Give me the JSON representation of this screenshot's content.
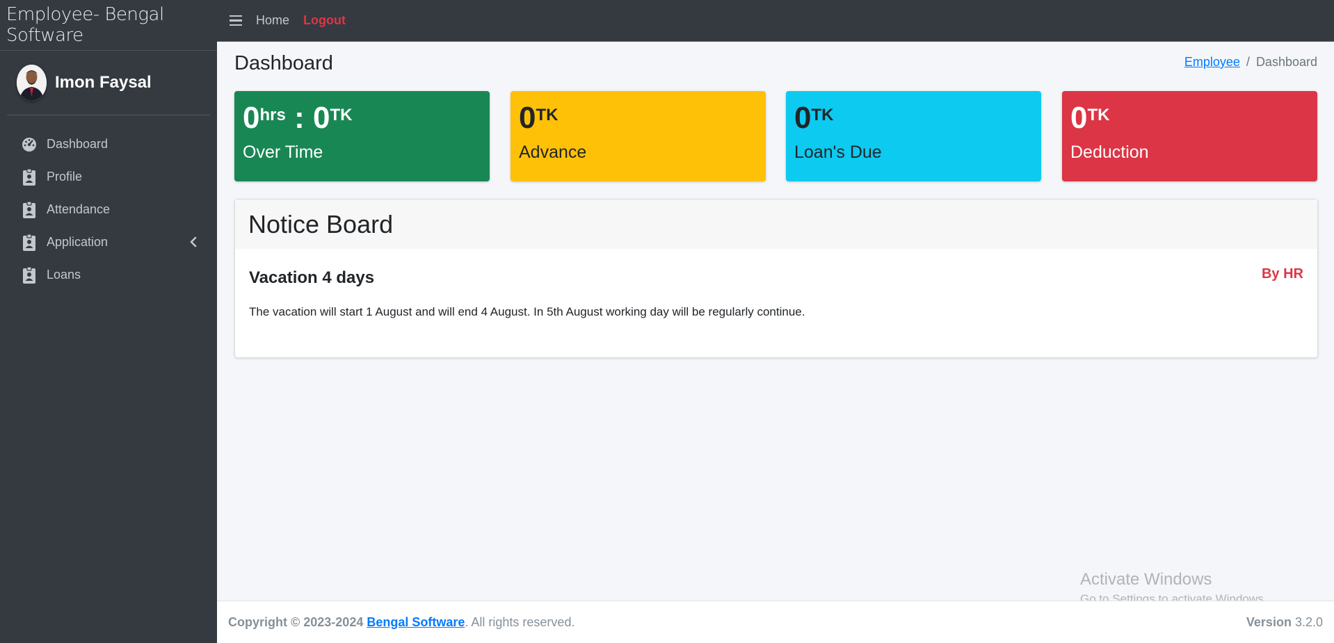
{
  "brand": {
    "title": "Employee- Bengal Software"
  },
  "user": {
    "name": "Imon Faysal"
  },
  "sidebar": {
    "items": [
      {
        "label": "Dashboard",
        "icon": "tachometer-icon"
      },
      {
        "label": "Profile",
        "icon": "id-badge-icon"
      },
      {
        "label": "Attendance",
        "icon": "id-badge-icon"
      },
      {
        "label": "Application",
        "icon": "id-badge-icon",
        "has_submenu": true
      },
      {
        "label": "Loans",
        "icon": "id-badge-icon"
      }
    ]
  },
  "topnav": {
    "home": "Home",
    "logout": "Logout"
  },
  "page": {
    "title": "Dashboard"
  },
  "breadcrumb": {
    "parent": "Employee",
    "separator": "/",
    "current": "Dashboard"
  },
  "stats": [
    {
      "value1": "0",
      "unit1": "hrs",
      "separator": " : ",
      "value2": "0",
      "unit2": "TK",
      "label": "Over Time",
      "color": "#198754",
      "text_color": "#ffffff"
    },
    {
      "value": "0",
      "unit": "TK",
      "label": "Advance",
      "color": "#ffc107",
      "text_color": "#212529"
    },
    {
      "value": "0",
      "unit": "TK",
      "label": "Loan's Due",
      "color": "#0dcaf0",
      "text_color": "#212529"
    },
    {
      "value": "0",
      "unit": "TK",
      "label": "Deduction",
      "color": "#dc3545",
      "text_color": "#ffffff"
    }
  ],
  "notice_board": {
    "title": "Notice Board",
    "notice": {
      "title": "Vacation 4 days",
      "author": "By HR",
      "body": "The vacation will start 1 August and will end 4 August. In 5th August working day will be regularly continue."
    }
  },
  "watermark": {
    "line1": "Activate Windows",
    "line2": "Go to Settings to activate Windows."
  },
  "footer": {
    "copyright_prefix": "Copyright © 2023-2024",
    "company": "Bengal Software",
    "suffix": ". All rights reserved.",
    "version_label": "Version",
    "version": "3.2.0"
  }
}
